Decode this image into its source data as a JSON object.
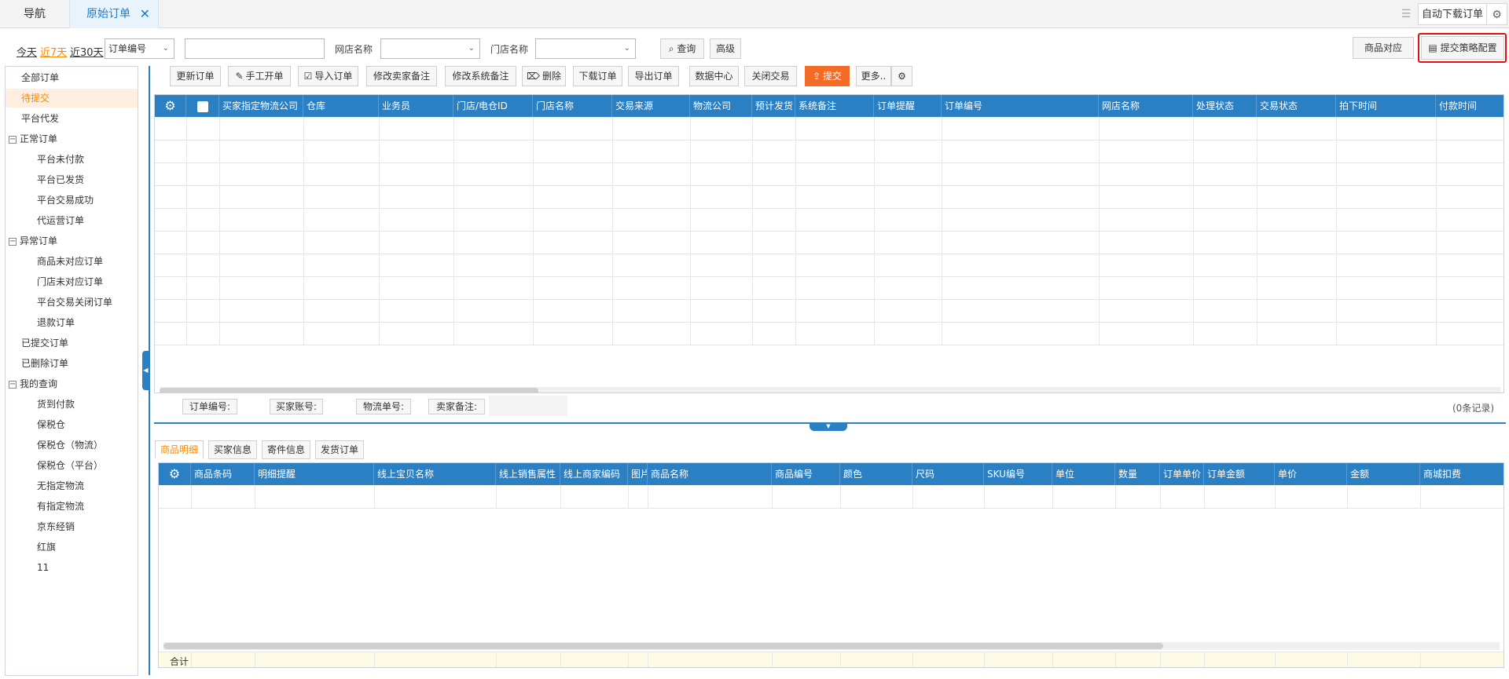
{
  "tabs": {
    "nav": "导航",
    "orders": "原始订单",
    "close": "✕"
  },
  "tabbar_right": {
    "list_icon": "list-icon",
    "auto_download": "自动下载订单",
    "gear": "⚙"
  },
  "filters": {
    "today": "今天",
    "last7": "近7天",
    "last30": "近30天",
    "field_select": "订单编号",
    "store_name_label": "网店名称",
    "shop_name_label": "门店名称",
    "query": "查询",
    "advanced": "高级",
    "product_match": "商品对应",
    "submit_config": "提交策略配置"
  },
  "sidebar": {
    "items": [
      {
        "label": "全部订单",
        "indent": 0,
        "toggle": ""
      },
      {
        "label": "待提交",
        "indent": 0,
        "toggle": "",
        "active": true
      },
      {
        "label": "平台代发",
        "indent": 0,
        "toggle": ""
      },
      {
        "label": "正常订单",
        "indent": 0,
        "toggle": "−"
      },
      {
        "label": "平台未付款",
        "indent": 1,
        "toggle": ""
      },
      {
        "label": "平台已发货",
        "indent": 1,
        "toggle": ""
      },
      {
        "label": "平台交易成功",
        "indent": 1,
        "toggle": ""
      },
      {
        "label": "代运营订单",
        "indent": 1,
        "toggle": ""
      },
      {
        "label": "异常订单",
        "indent": 0,
        "toggle": "−"
      },
      {
        "label": "商品未对应订单",
        "indent": 1,
        "toggle": ""
      },
      {
        "label": "门店未对应订单",
        "indent": 1,
        "toggle": ""
      },
      {
        "label": "平台交易关闭订单",
        "indent": 1,
        "toggle": ""
      },
      {
        "label": "退款订单",
        "indent": 1,
        "toggle": ""
      },
      {
        "label": "已提交订单",
        "indent": 0,
        "toggle": ""
      },
      {
        "label": "已删除订单",
        "indent": 0,
        "toggle": ""
      },
      {
        "label": "我的查询",
        "indent": 0,
        "toggle": "−"
      },
      {
        "label": "货到付款",
        "indent": 1,
        "toggle": ""
      },
      {
        "label": "保税仓",
        "indent": 1,
        "toggle": ""
      },
      {
        "label": "保税仓（物流）",
        "indent": 1,
        "toggle": ""
      },
      {
        "label": "保税仓（平台）",
        "indent": 1,
        "toggle": ""
      },
      {
        "label": "无指定物流",
        "indent": 1,
        "toggle": ""
      },
      {
        "label": "有指定物流",
        "indent": 1,
        "toggle": ""
      },
      {
        "label": "京东经销",
        "indent": 1,
        "toggle": ""
      },
      {
        "label": "红旗",
        "indent": 1,
        "toggle": ""
      },
      {
        "label": "11",
        "indent": 1,
        "toggle": ""
      }
    ]
  },
  "toolbar": [
    {
      "label": "更新订单"
    },
    {
      "label": "手工开单",
      "icon": "✎"
    },
    {
      "label": "导入订单",
      "icon": "☑"
    },
    {
      "label": "修改卖家备注"
    },
    {
      "label": "修改系统备注"
    },
    {
      "label": "删除",
      "icon": "⌦"
    },
    {
      "label": "下载订单"
    },
    {
      "label": "导出订单"
    },
    {
      "label": "数据中心"
    },
    {
      "label": "关闭交易"
    },
    {
      "label": "提交",
      "icon": "⇪"
    },
    {
      "label": "更多.."
    },
    {
      "label": "⚙"
    }
  ],
  "order_grid": {
    "columns": [
      "买家指定物流公司",
      "仓库",
      "业务员",
      "门店/电仓ID",
      "门店名称",
      "交易来源",
      "物流公司",
      "预计发货",
      "系统备注",
      "订单提醒",
      "订单编号",
      "网店名称",
      "处理状态",
      "交易状态",
      "拍下时间",
      "付款时间"
    ],
    "footer_labels": [
      "订单编号:",
      "买家账号:",
      "物流单号:",
      "卖家备注:"
    ],
    "record_count": "(0条记录)"
  },
  "detail_tabs": [
    "商品明细",
    "买家信息",
    "寄件信息",
    "发货订单"
  ],
  "detail_grid": {
    "columns": [
      "商品条码",
      "明细提醒",
      "线上宝贝名称",
      "线上销售属性",
      "线上商家编码",
      "图片",
      "商品名称",
      "商品编号",
      "颜色",
      "尺码",
      "SKU编号",
      "单位",
      "数量",
      "订单单价",
      "订单金额",
      "单价",
      "金额",
      "商城扣费"
    ],
    "total_label": "合计"
  }
}
